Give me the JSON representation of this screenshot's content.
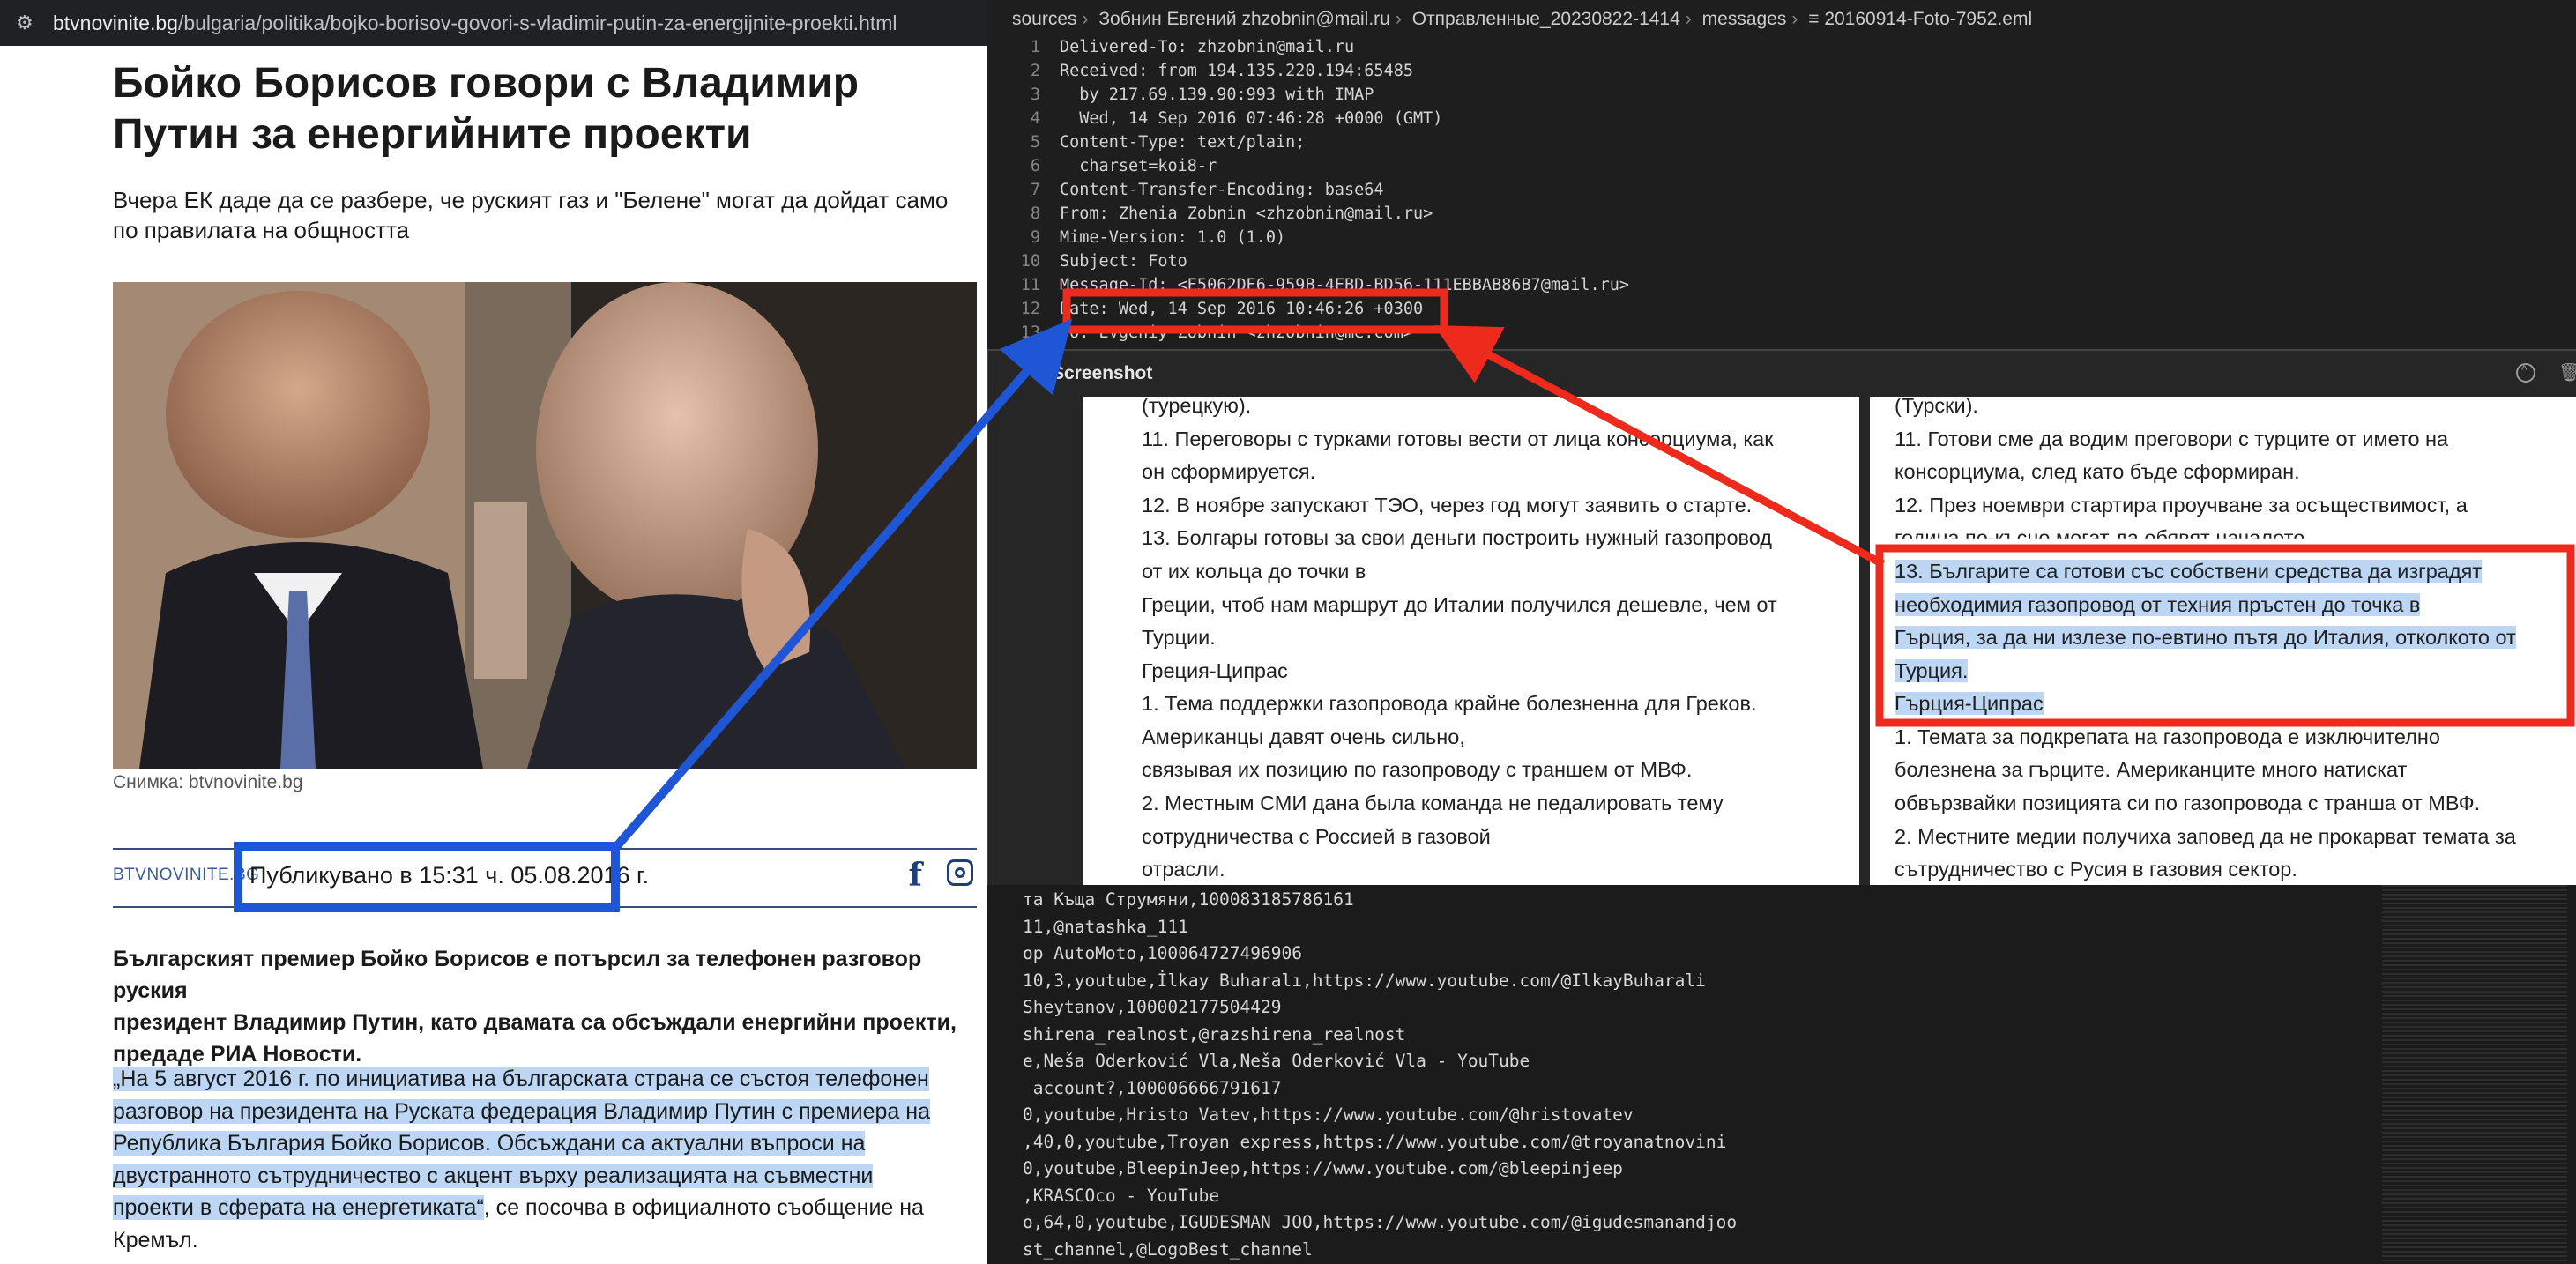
{
  "browser": {
    "url_domain": "btvnovinite.bg",
    "url_path": "/bulgaria/politika/bojko-borisov-govori-s-vladimir-putin-za-energijnite-proekti.html",
    "headline": "Бойко Борисов говори с Владимир Путин за енергийните проекти",
    "subtitle": "Вчера ЕК даде да се разбере, че руският газ и \"Белене\" могат да дойдат само по правилата на общността",
    "photo_caption": "Снимка: btvnovinite.bg",
    "source_label": "BTVNOVINITE.BG",
    "published": "Публикувано в 15:31 ч. 05.08.2016 г.",
    "facebook_glyph": "f",
    "lede_lines": [
      "Българският премиер Бойко Борисов е потърсил за телефонен разговор руския",
      "президент Владимир Путин, като двамата са обсъждали енергийни проекти,",
      "предаде РИА Новости."
    ],
    "quote_lines": [
      "„На 5 август 2016 г. по инициатива на българската страна се състоя телефонен",
      "разговор на президента на Руската федерация Владимир Путин с премиера на",
      "Република България Бойко Борисов. Обсъждани са актуални въпроси на",
      "двустранното сътрудничество с акцент върху реализацията на съвместни",
      "проекти в сферата на енергетиката“"
    ],
    "quote_tail": ", се посочва в официалното съобщение на",
    "quote_last": "Кремъл."
  },
  "editor": {
    "breadcrumb": [
      "sources",
      "Зобнин Евгений zhzobnin@mail.ru",
      "Отправленные_20230822-1414",
      "messages",
      "20160914-Foto-7952.eml"
    ],
    "lines": [
      {
        "n": "1",
        "t": "Delivered-To: zhzobnin@mail.ru"
      },
      {
        "n": "2",
        "t": "Received: from 194.135.220.194:65485"
      },
      {
        "n": "3",
        "t": "  by 217.69.139.90:993 with IMAP"
      },
      {
        "n": "4",
        "t": "  Wed, 14 Sep 2016 07:46:28 +0000 (GMT)"
      },
      {
        "n": "5",
        "t": "Content-Type: text/plain;"
      },
      {
        "n": "6",
        "t": "  charset=koi8-r"
      },
      {
        "n": "7",
        "t": "Content-Transfer-Encoding: base64"
      },
      {
        "n": "8",
        "t": "From: Zhenia Zobnin <zhzobnin@mail.ru>"
      },
      {
        "n": "9",
        "t": "Mime-Version: 1.0 (1.0)"
      },
      {
        "n": "10",
        "t": "Subject: Foto"
      },
      {
        "n": "11",
        "t": "Message-Id: <E5062DE6-959B-4EBD-BD56-111EBBAB86B7@mail.ru>"
      },
      {
        "n": "12",
        "t": "Date: Wed, 14 Sep 2016 10:46:26 +0300"
      },
      {
        "n": "13",
        "t": "To: Evgeniy Zobnin <zhzobnin@me.com>"
      }
    ]
  },
  "viewer": {
    "title": "Screenshot",
    "left_lines": [
      "(турецкую).",
      "11. Переговоры с турками готовы вести от лица консорциума, как",
      "он сформируется.",
      "12. В ноябре запускают ТЭО, через год могут заявить о старте.",
      "13. Болгары готовы за свои деньги построить нужный газопровод",
      "от их кольца до точки в",
      "Греции, чтоб нам маршрут до Италии получился дешевле, чем от",
      "Турции.",
      "Греция-Ципрас",
      "1. Тема поддержки газопровода крайне болезненна для Греков.",
      "Американцы давят очень сильно,",
      "связывая их позицию по газопроводу с траншем от МВФ.",
      "2. Местным СМИ дана была команда не педалировать тему",
      "сотрудничества с Россией в газовой",
      "отрасли."
    ],
    "right_lines": [
      "(Турски).",
      "11. Готови сме да водим преговори с турците от името на",
      "консорциума, след като бъде сформиран.",
      "12. През ноември стартира проучване за осъществимост, а",
      "година по-късно могат да обявят началото.",
      "13. Българите са готови със собствени средства да изградят",
      "необходимия газопровод от техния пръстен до точка в",
      "Гърция, за да ни излезе по-евтино пътя до Италия, отколкото от",
      "Турция.",
      "Гърция-Ципрас",
      "1. Темата за подкрепата на газопровода е изключително",
      "болезнена за гърците. Американците много натискат",
      "обвързвайки позицията си по газопровода с транша от МВФ.",
      "2. Местните медии получиха заповед да не прокарват темата за",
      "сътрудничество с Русия в газовия сектор."
    ]
  },
  "terminal": {
    "lines": [
      "та Къща Струмяни,100083185786161",
      "11,@natashka_111",
      "op AutoMoto,100064727496906",
      "10,3,youtube,İlkay Buharalı,https://www.youtube.com/@IlkayBuharali",
      "Sheytanov,100002177504429",
      "shirena_realnost,@razshirena_realnost",
      "e,Neša Oderković Vla,Neša Oderković Vla - YouTube",
      " account?,100006666791617",
      "0,youtube,Hristo Vatev,https://www.youtube.com/@hristovatev",
      ",40,0,youtube,Troyan express,https://www.youtube.com/@troyanatnovini",
      "0,youtube,BleepinJeep,https://www.youtube.com/@bleepinjeep",
      ",KRASCOco - YouTube",
      "o,64,0,youtube,IGUDESMAN JOO,https://www.youtube.com/@igudesmanandjoo",
      "st_channel,@LogoBest_channel"
    ]
  },
  "colors": {
    "annotation_red": "#ee2a1c",
    "annotation_blue": "#1f56d6",
    "selection_highlight": "#bcd6f4"
  }
}
